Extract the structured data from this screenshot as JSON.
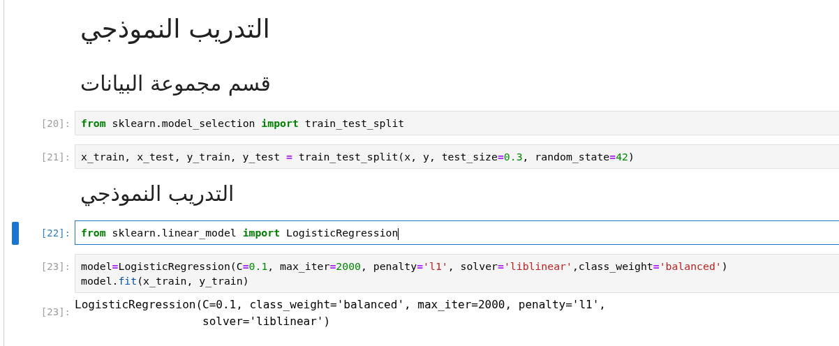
{
  "cells": [
    {
      "kind": "title",
      "text": "التدريب النموذجي"
    },
    {
      "kind": "heading",
      "text": "قسم مجموعة البيانات"
    },
    {
      "kind": "code",
      "prompt": "[20]:",
      "selected": false,
      "lines": [
        [
          {
            "t": "from",
            "kind": "keyword"
          },
          {
            "t": " sklearn.model_selection ",
            "kind": "plain"
          },
          {
            "t": "import",
            "kind": "keyword"
          },
          {
            "t": " train_test_split",
            "kind": "plain"
          }
        ]
      ]
    },
    {
      "kind": "code",
      "prompt": "[21]:",
      "selected": false,
      "lines": [
        [
          {
            "t": "x_train, x_test, y_train, y_test ",
            "kind": "plain"
          },
          {
            "t": "=",
            "kind": "operator"
          },
          {
            "t": " train_test_split(x, y, test_size",
            "kind": "plain"
          },
          {
            "t": "=",
            "kind": "operator"
          },
          {
            "t": "0.3",
            "kind": "number"
          },
          {
            "t": ", random_state",
            "kind": "plain"
          },
          {
            "t": "=",
            "kind": "operator"
          },
          {
            "t": "42",
            "kind": "number"
          },
          {
            "t": ")",
            "kind": "plain"
          }
        ]
      ]
    },
    {
      "kind": "heading",
      "text": "التدريب النموذجي"
    },
    {
      "kind": "code",
      "prompt": "[22]:",
      "selected": true,
      "lines": [
        [
          {
            "t": "from",
            "kind": "keyword"
          },
          {
            "t": " sklearn.linear_model ",
            "kind": "plain"
          },
          {
            "t": "import",
            "kind": "keyword"
          },
          {
            "t": " LogisticRegression",
            "kind": "plain"
          }
        ]
      ]
    },
    {
      "kind": "code",
      "prompt": "[23]:",
      "selected": false,
      "lines": [
        [
          {
            "t": "model",
            "kind": "plain"
          },
          {
            "t": "=",
            "kind": "operator"
          },
          {
            "t": "LogisticRegression(C",
            "kind": "plain"
          },
          {
            "t": "=",
            "kind": "operator"
          },
          {
            "t": "0.1",
            "kind": "number"
          },
          {
            "t": ", max_iter",
            "kind": "plain"
          },
          {
            "t": "=",
            "kind": "operator"
          },
          {
            "t": "2000",
            "kind": "number"
          },
          {
            "t": ", penalty",
            "kind": "plain"
          },
          {
            "t": "=",
            "kind": "operator"
          },
          {
            "t": "'l1'",
            "kind": "string"
          },
          {
            "t": ", solver",
            "kind": "plain"
          },
          {
            "t": "=",
            "kind": "operator"
          },
          {
            "t": "'liblinear'",
            "kind": "string"
          },
          {
            "t": ",class_weight",
            "kind": "plain"
          },
          {
            "t": "=",
            "kind": "operator"
          },
          {
            "t": "'balanced'",
            "kind": "string"
          },
          {
            "t": ")",
            "kind": "plain"
          }
        ],
        [
          {
            "t": "model.",
            "kind": "plain"
          },
          {
            "t": "fit",
            "kind": "property"
          },
          {
            "t": "(x_train, y_train)",
            "kind": "plain"
          }
        ]
      ]
    },
    {
      "kind": "output",
      "prompt": "[23]:",
      "text": "LogisticRegression(C=0.1, class_weight='balanced', max_iter=2000, penalty='l1',\n                   solver='liblinear')"
    }
  ]
}
